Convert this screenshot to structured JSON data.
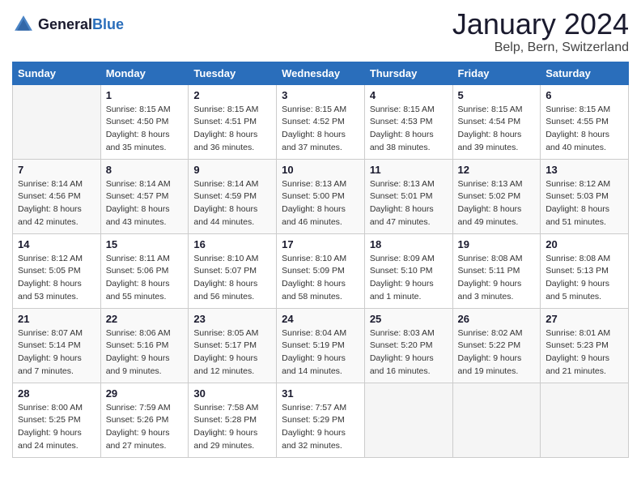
{
  "header": {
    "logo_general": "General",
    "logo_blue": "Blue",
    "main_title": "January 2024",
    "subtitle": "Belp, Bern, Switzerland"
  },
  "weekdays": [
    "Sunday",
    "Monday",
    "Tuesday",
    "Wednesday",
    "Thursday",
    "Friday",
    "Saturday"
  ],
  "weeks": [
    [
      {
        "day": "",
        "sunrise": "",
        "sunset": "",
        "daylight": ""
      },
      {
        "day": "1",
        "sunrise": "Sunrise: 8:15 AM",
        "sunset": "Sunset: 4:50 PM",
        "daylight": "Daylight: 8 hours and 35 minutes."
      },
      {
        "day": "2",
        "sunrise": "Sunrise: 8:15 AM",
        "sunset": "Sunset: 4:51 PM",
        "daylight": "Daylight: 8 hours and 36 minutes."
      },
      {
        "day": "3",
        "sunrise": "Sunrise: 8:15 AM",
        "sunset": "Sunset: 4:52 PM",
        "daylight": "Daylight: 8 hours and 37 minutes."
      },
      {
        "day": "4",
        "sunrise": "Sunrise: 8:15 AM",
        "sunset": "Sunset: 4:53 PM",
        "daylight": "Daylight: 8 hours and 38 minutes."
      },
      {
        "day": "5",
        "sunrise": "Sunrise: 8:15 AM",
        "sunset": "Sunset: 4:54 PM",
        "daylight": "Daylight: 8 hours and 39 minutes."
      },
      {
        "day": "6",
        "sunrise": "Sunrise: 8:15 AM",
        "sunset": "Sunset: 4:55 PM",
        "daylight": "Daylight: 8 hours and 40 minutes."
      }
    ],
    [
      {
        "day": "7",
        "sunrise": "Sunrise: 8:14 AM",
        "sunset": "Sunset: 4:56 PM",
        "daylight": "Daylight: 8 hours and 42 minutes."
      },
      {
        "day": "8",
        "sunrise": "Sunrise: 8:14 AM",
        "sunset": "Sunset: 4:57 PM",
        "daylight": "Daylight: 8 hours and 43 minutes."
      },
      {
        "day": "9",
        "sunrise": "Sunrise: 8:14 AM",
        "sunset": "Sunset: 4:59 PM",
        "daylight": "Daylight: 8 hours and 44 minutes."
      },
      {
        "day": "10",
        "sunrise": "Sunrise: 8:13 AM",
        "sunset": "Sunset: 5:00 PM",
        "daylight": "Daylight: 8 hours and 46 minutes."
      },
      {
        "day": "11",
        "sunrise": "Sunrise: 8:13 AM",
        "sunset": "Sunset: 5:01 PM",
        "daylight": "Daylight: 8 hours and 47 minutes."
      },
      {
        "day": "12",
        "sunrise": "Sunrise: 8:13 AM",
        "sunset": "Sunset: 5:02 PM",
        "daylight": "Daylight: 8 hours and 49 minutes."
      },
      {
        "day": "13",
        "sunrise": "Sunrise: 8:12 AM",
        "sunset": "Sunset: 5:03 PM",
        "daylight": "Daylight: 8 hours and 51 minutes."
      }
    ],
    [
      {
        "day": "14",
        "sunrise": "Sunrise: 8:12 AM",
        "sunset": "Sunset: 5:05 PM",
        "daylight": "Daylight: 8 hours and 53 minutes."
      },
      {
        "day": "15",
        "sunrise": "Sunrise: 8:11 AM",
        "sunset": "Sunset: 5:06 PM",
        "daylight": "Daylight: 8 hours and 55 minutes."
      },
      {
        "day": "16",
        "sunrise": "Sunrise: 8:10 AM",
        "sunset": "Sunset: 5:07 PM",
        "daylight": "Daylight: 8 hours and 56 minutes."
      },
      {
        "day": "17",
        "sunrise": "Sunrise: 8:10 AM",
        "sunset": "Sunset: 5:09 PM",
        "daylight": "Daylight: 8 hours and 58 minutes."
      },
      {
        "day": "18",
        "sunrise": "Sunrise: 8:09 AM",
        "sunset": "Sunset: 5:10 PM",
        "daylight": "Daylight: 9 hours and 1 minute."
      },
      {
        "day": "19",
        "sunrise": "Sunrise: 8:08 AM",
        "sunset": "Sunset: 5:11 PM",
        "daylight": "Daylight: 9 hours and 3 minutes."
      },
      {
        "day": "20",
        "sunrise": "Sunrise: 8:08 AM",
        "sunset": "Sunset: 5:13 PM",
        "daylight": "Daylight: 9 hours and 5 minutes."
      }
    ],
    [
      {
        "day": "21",
        "sunrise": "Sunrise: 8:07 AM",
        "sunset": "Sunset: 5:14 PM",
        "daylight": "Daylight: 9 hours and 7 minutes."
      },
      {
        "day": "22",
        "sunrise": "Sunrise: 8:06 AM",
        "sunset": "Sunset: 5:16 PM",
        "daylight": "Daylight: 9 hours and 9 minutes."
      },
      {
        "day": "23",
        "sunrise": "Sunrise: 8:05 AM",
        "sunset": "Sunset: 5:17 PM",
        "daylight": "Daylight: 9 hours and 12 minutes."
      },
      {
        "day": "24",
        "sunrise": "Sunrise: 8:04 AM",
        "sunset": "Sunset: 5:19 PM",
        "daylight": "Daylight: 9 hours and 14 minutes."
      },
      {
        "day": "25",
        "sunrise": "Sunrise: 8:03 AM",
        "sunset": "Sunset: 5:20 PM",
        "daylight": "Daylight: 9 hours and 16 minutes."
      },
      {
        "day": "26",
        "sunrise": "Sunrise: 8:02 AM",
        "sunset": "Sunset: 5:22 PM",
        "daylight": "Daylight: 9 hours and 19 minutes."
      },
      {
        "day": "27",
        "sunrise": "Sunrise: 8:01 AM",
        "sunset": "Sunset: 5:23 PM",
        "daylight": "Daylight: 9 hours and 21 minutes."
      }
    ],
    [
      {
        "day": "28",
        "sunrise": "Sunrise: 8:00 AM",
        "sunset": "Sunset: 5:25 PM",
        "daylight": "Daylight: 9 hours and 24 minutes."
      },
      {
        "day": "29",
        "sunrise": "Sunrise: 7:59 AM",
        "sunset": "Sunset: 5:26 PM",
        "daylight": "Daylight: 9 hours and 27 minutes."
      },
      {
        "day": "30",
        "sunrise": "Sunrise: 7:58 AM",
        "sunset": "Sunset: 5:28 PM",
        "daylight": "Daylight: 9 hours and 29 minutes."
      },
      {
        "day": "31",
        "sunrise": "Sunrise: 7:57 AM",
        "sunset": "Sunset: 5:29 PM",
        "daylight": "Daylight: 9 hours and 32 minutes."
      },
      {
        "day": "",
        "sunrise": "",
        "sunset": "",
        "daylight": ""
      },
      {
        "day": "",
        "sunrise": "",
        "sunset": "",
        "daylight": ""
      },
      {
        "day": "",
        "sunrise": "",
        "sunset": "",
        "daylight": ""
      }
    ]
  ]
}
